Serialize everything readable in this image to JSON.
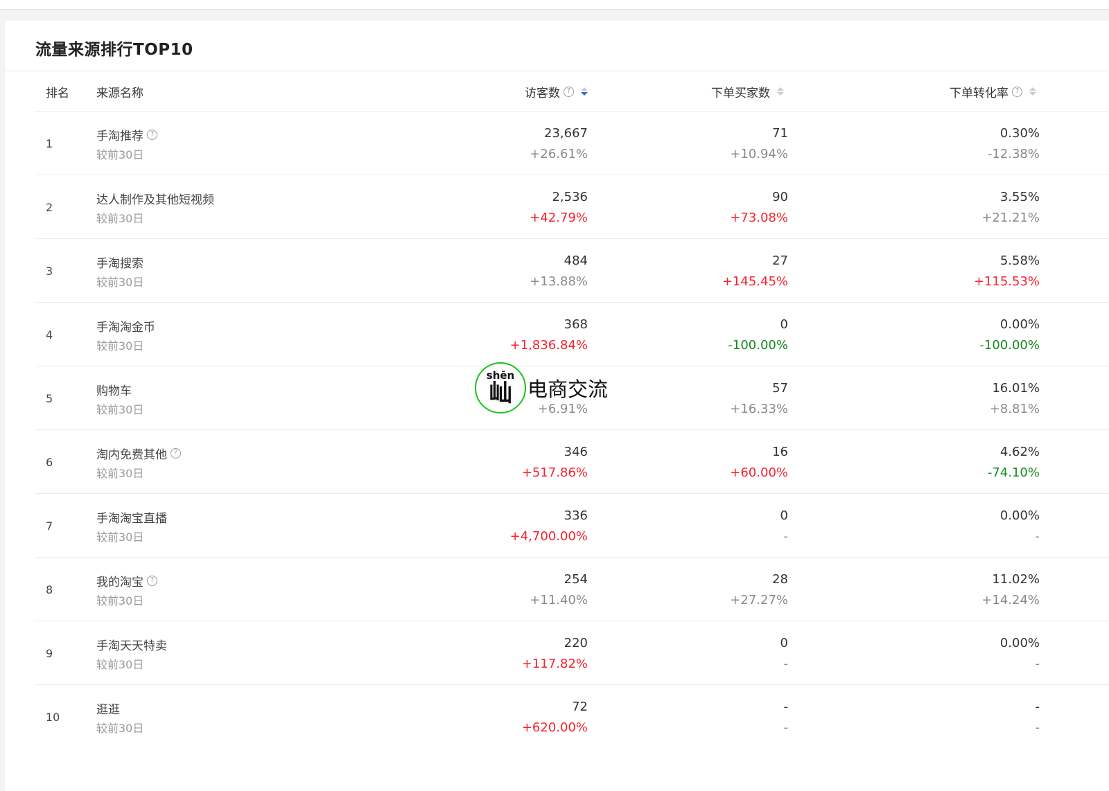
{
  "page": {
    "title": "流量来源排行TOP10"
  },
  "table": {
    "headers": {
      "rank": "排名",
      "name": "来源名称",
      "visitors": "访客数",
      "buyers": "下单买家数",
      "conversion": "下单转化率"
    },
    "rows": [
      {
        "rank": "1",
        "name": "手淘推荐",
        "has_help": true,
        "compare": "较前30日",
        "visitors": "23,667",
        "visitors_change": "+26.61%",
        "visitors_color": "gray",
        "buyers": "71",
        "buyers_change": "+10.94%",
        "buyers_color": "gray",
        "rate": "0.30%",
        "rate_change": "-12.38%",
        "rate_color": "gray"
      },
      {
        "rank": "2",
        "name": "达人制作及其他短视频",
        "has_help": false,
        "compare": "较前30日",
        "visitors": "2,536",
        "visitors_change": "+42.79%",
        "visitors_color": "red",
        "buyers": "90",
        "buyers_change": "+73.08%",
        "buyers_color": "red",
        "rate": "3.55%",
        "rate_change": "+21.21%",
        "rate_color": "gray"
      },
      {
        "rank": "3",
        "name": "手淘搜索",
        "has_help": false,
        "compare": "较前30日",
        "visitors": "484",
        "visitors_change": "+13.88%",
        "visitors_color": "gray",
        "buyers": "27",
        "buyers_change": "+145.45%",
        "buyers_color": "red",
        "rate": "5.58%",
        "rate_change": "+115.53%",
        "rate_color": "red"
      },
      {
        "rank": "4",
        "name": "手淘淘金币",
        "has_help": false,
        "compare": "较前30日",
        "visitors": "368",
        "visitors_change": "+1,836.84%",
        "visitors_color": "red",
        "buyers": "0",
        "buyers_change": "-100.00%",
        "buyers_color": "green",
        "rate": "0.00%",
        "rate_change": "-100.00%",
        "rate_color": "green"
      },
      {
        "rank": "5",
        "name": "购物车",
        "has_help": false,
        "compare": "较前30日",
        "visitors": "",
        "visitors_change": "+6.91%",
        "visitors_color": "gray",
        "buyers": "57",
        "buyers_change": "+16.33%",
        "buyers_color": "gray",
        "rate": "16.01%",
        "rate_change": "+8.81%",
        "rate_color": "gray"
      },
      {
        "rank": "6",
        "name": "淘内免费其他",
        "has_help": true,
        "compare": "较前30日",
        "visitors": "346",
        "visitors_change": "+517.86%",
        "visitors_color": "red",
        "buyers": "16",
        "buyers_change": "+60.00%",
        "buyers_color": "red",
        "rate": "4.62%",
        "rate_change": "-74.10%",
        "rate_color": "green"
      },
      {
        "rank": "7",
        "name": "手淘淘宝直播",
        "has_help": false,
        "compare": "较前30日",
        "visitors": "336",
        "visitors_change": "+4,700.00%",
        "visitors_color": "red",
        "buyers": "0",
        "buyers_change": "-",
        "buyers_color": "gray",
        "rate": "0.00%",
        "rate_change": "-",
        "rate_color": "gray"
      },
      {
        "rank": "8",
        "name": "我的淘宝",
        "has_help": true,
        "compare": "较前30日",
        "visitors": "254",
        "visitors_change": "+11.40%",
        "visitors_color": "gray",
        "buyers": "28",
        "buyers_change": "+27.27%",
        "buyers_color": "gray",
        "rate": "11.02%",
        "rate_change": "+14.24%",
        "rate_color": "gray"
      },
      {
        "rank": "9",
        "name": "手淘天天特卖",
        "has_help": false,
        "compare": "较前30日",
        "visitors": "220",
        "visitors_change": "+117.82%",
        "visitors_color": "red",
        "buyers": "0",
        "buyers_change": "-",
        "buyers_color": "gray",
        "rate": "0.00%",
        "rate_change": "-",
        "rate_color": "gray"
      },
      {
        "rank": "10",
        "name": "逛逛",
        "has_help": false,
        "compare": "较前30日",
        "visitors": "72",
        "visitors_change": "+620.00%",
        "visitors_color": "red",
        "buyers": "-",
        "buyers_change": "-",
        "buyers_color": "gray",
        "rate": "-",
        "rate_change": "-",
        "rate_color": "gray"
      }
    ]
  },
  "watermark": {
    "pinyin": "shēn",
    "char": "屾",
    "text": "电商交流",
    "ring_color": "#1bc21b"
  },
  "icons": {
    "help": "?",
    "help_icon": "question-circle-icon",
    "sort_icon": "sort-caret-icon"
  },
  "colors": {
    "up_red": "#f5222d",
    "down_green": "#148a1c",
    "neutral_gray": "#8a8a8a",
    "sort_active": "#2f6bd8"
  }
}
